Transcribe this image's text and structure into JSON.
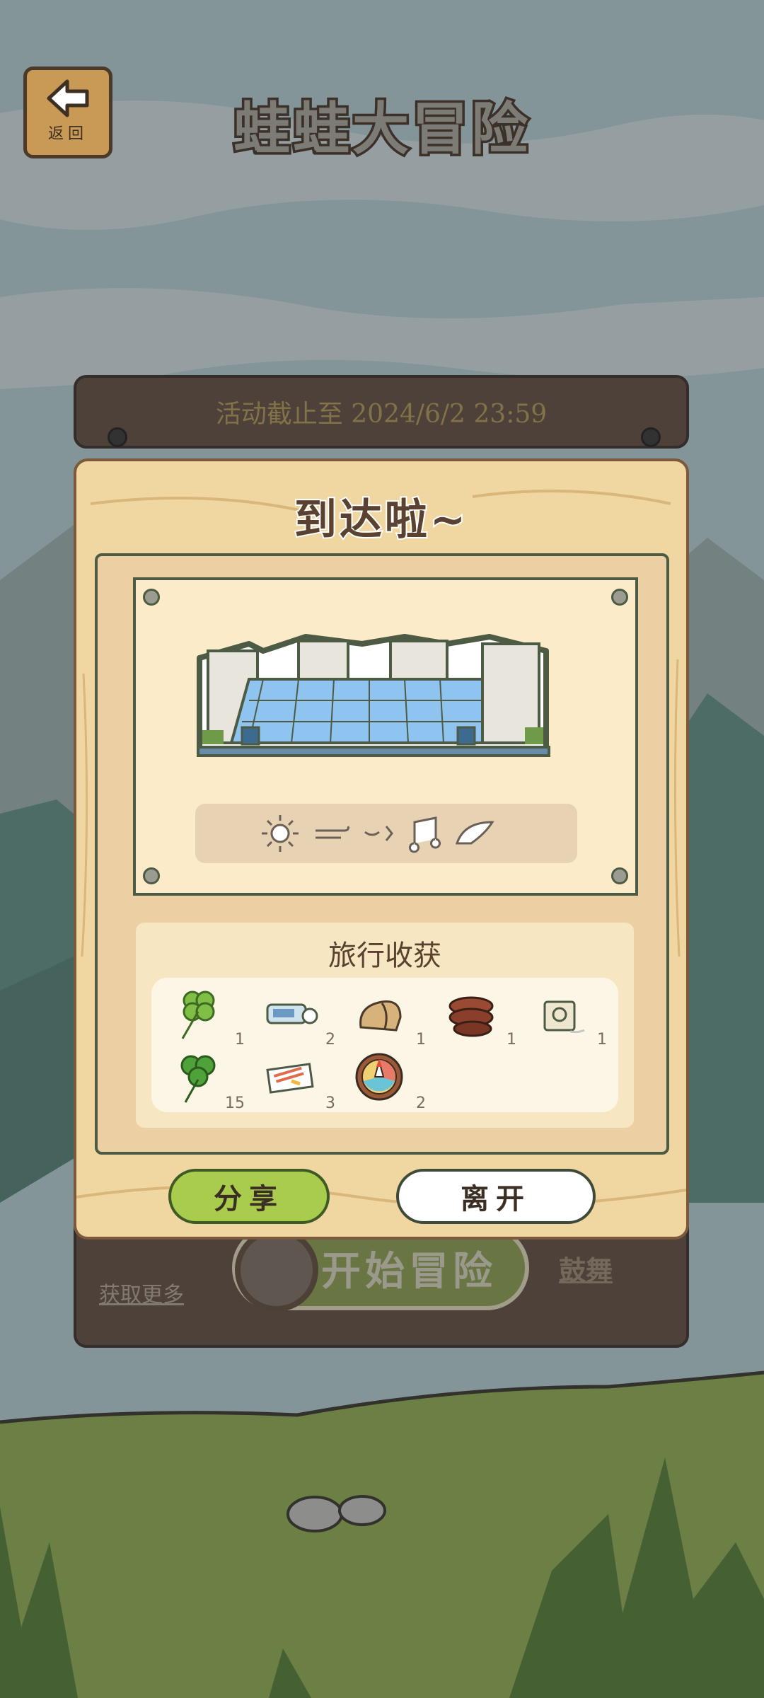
{
  "header": {
    "back_label": "返回",
    "title": "蛙蛙大冒险"
  },
  "event": {
    "deadline_text": "活动截止至 2024/6/2 23:59"
  },
  "lower_board": {
    "get_more_label": "获取更多",
    "start_label": "开始冒险",
    "dance_label": "鼓舞"
  },
  "modal": {
    "title": "到达啦~",
    "postcard": {
      "weather_icons": [
        "sun-icon",
        "wind-icon",
        "blink-icon",
        "music-note-icon",
        "wing-icon"
      ]
    },
    "harvest": {
      "title": "旅行收获",
      "items": [
        {
          "icon": "four-leaf-clover-icon",
          "count": "1"
        },
        {
          "icon": "ticket-icon",
          "count": "2"
        },
        {
          "icon": "bread-icon",
          "count": "1"
        },
        {
          "icon": "log-icon",
          "count": "1"
        },
        {
          "icon": "seed-bag-icon",
          "count": "1"
        },
        {
          "icon": "clover-icon",
          "count": "15"
        },
        {
          "icon": "postcard-icon",
          "count": "3"
        },
        {
          "icon": "compass-icon",
          "count": "2"
        }
      ]
    },
    "share_label": "分享",
    "leave_label": "离开"
  },
  "colors": {
    "board_wood": "#5b463a",
    "modal_wood": "#f0d7a1",
    "share_green": "#a9cc4e",
    "outline": "#4d5a44"
  }
}
